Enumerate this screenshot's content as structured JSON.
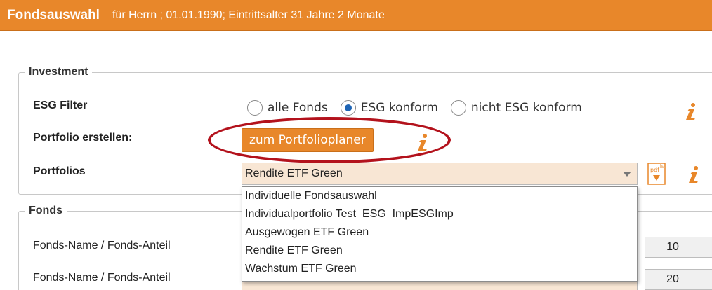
{
  "header": {
    "title": "Fondsauswahl",
    "subtitle": "für Herrn  ; 01.01.1990;  Eintrittsalter 31 Jahre 2 Monate"
  },
  "investment": {
    "legend": "Investment",
    "esg_label": "ESG Filter",
    "esg_options": [
      {
        "label": "alle Fonds",
        "selected": false
      },
      {
        "label": "ESG konform",
        "selected": true
      },
      {
        "label": "nicht ESG konform",
        "selected": false
      }
    ],
    "portfolio_create_label": "Portfolio erstellen:",
    "portfolio_planer_button": "zum Portfolioplaner",
    "portfolios_label": "Portfolios",
    "portfolios_selected": "Rendite ETF Green",
    "portfolios_options": [
      "Individuelle Fondsauswahl",
      "Individualportfolio Test_ESG_ImpESGImp",
      "Ausgewogen ETF Green",
      "Rendite ETF Green",
      "Wachstum ETF Green"
    ]
  },
  "fonds": {
    "legend": "Fonds",
    "rows": [
      {
        "label": "Fonds-Name / Fonds-Anteil",
        "value": "10"
      },
      {
        "label": "Fonds-Name / Fonds-Anteil",
        "value": "20"
      }
    ]
  },
  "colors": {
    "accent": "#e8872a",
    "highlight": "#b3121c",
    "radio_selected": "#1e64b4",
    "select_bg": "#f8e6d4"
  }
}
